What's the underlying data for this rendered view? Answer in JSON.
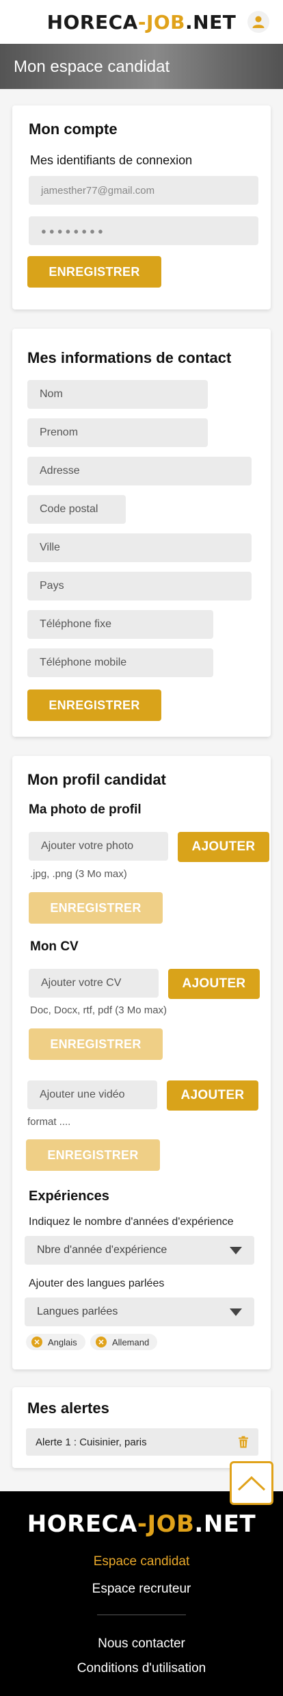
{
  "header": {
    "logo_main": "HORECA",
    "logo_dash": "-",
    "logo_job": "JOB",
    "logo_net": ".NET"
  },
  "banner": {
    "title": "Mon espace candidat"
  },
  "account": {
    "title": "Mon compte",
    "subtitle": "Mes identifiants de connexion",
    "email_value": "jamesther77@gmail.com",
    "password_mask": "●●●●●●●●",
    "save_label": "ENREGISTRER"
  },
  "contact": {
    "title": "Mes informations de contact",
    "placeholders": {
      "nom": "Nom",
      "prenom": "Prenom",
      "adresse": "Adresse",
      "code_postal": "Code postal",
      "ville": "Ville",
      "pays": "Pays",
      "tel_fixe": "Téléphone fixe",
      "tel_mobile": "Téléphone mobile"
    },
    "save_label": "ENREGISTRER"
  },
  "profile": {
    "title": "Mon profil candidat",
    "photo": {
      "title": "Ma photo de profil",
      "placeholder": "Ajouter votre photo",
      "add_label": "AJOUTER",
      "hint": ".jpg, .png (3 Mo max)",
      "save_label": "ENREGISTRER"
    },
    "cv": {
      "title": "Mon CV",
      "placeholder": "Ajouter votre CV",
      "add_label": "AJOUTER",
      "hint": "Doc, Docx, rtf, pdf (3 Mo max)",
      "save_label": "ENREGISTRER"
    },
    "video": {
      "placeholder": "Ajouter une vidéo",
      "add_label": "AJOUTER",
      "hint": "format ....",
      "save_label": "ENREGISTRER"
    },
    "experience": {
      "title": "Expériences",
      "years_label": "Indiquez le nombre d'années d'expérience",
      "years_select": "Nbre d'année d'expérience",
      "lang_label": "Ajouter des langues parlées",
      "lang_select": "Langues parlées",
      "chips": [
        "Anglais",
        "Allemand"
      ]
    }
  },
  "alerts": {
    "title": "Mes alertes",
    "items": [
      "Alerte 1 : Cuisinier, paris"
    ]
  },
  "footer": {
    "logo_main": "HORECA",
    "logo_dash": "-",
    "logo_job": "JOB",
    "logo_net": ".NET",
    "link_candidate": "Espace candidat",
    "link_recruiter": "Espace recruteur",
    "link_contact": "Nous contacter",
    "link_terms": "Conditions d'utilisation"
  },
  "colors": {
    "accent": "#d9a31a",
    "accent_light": "#efcf86",
    "footer_bg": "#000000"
  }
}
